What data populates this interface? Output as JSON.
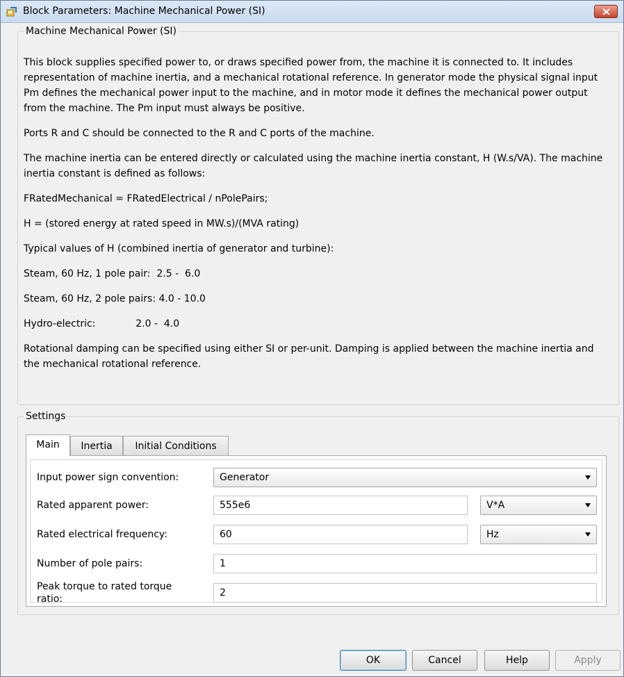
{
  "window": {
    "title": "Block Parameters: Machine Mechanical Power (SI)"
  },
  "description": {
    "group_title": "Machine Mechanical Power (SI)",
    "paragraphs": [
      "This block supplies specified power to, or draws specified power from, the machine it is connected to. It includes representation of machine inertia, and a mechanical rotational reference. In generator mode the physical signal input Pm defines the mechanical power input to the machine, and in motor mode it defines the mechanical power output from the machine. The Pm input must always be positive.",
      "Ports R and C should be connected to the R and C ports of the machine.",
      "The machine inertia can be entered directly or calculated using the machine inertia constant, H (W.s/VA). The machine inertia constant is defined as follows:",
      "FRatedMechanical = FRatedElectrical / nPolePairs;",
      "H = (stored energy at rated speed in MW.s)/(MVA rating)",
      "Typical values of H (combined inertia of generator and turbine):",
      "Steam, 60 Hz, 1 pole pair:  2.5 -  6.0",
      "Steam, 60 Hz, 2 pole pairs: 4.0 - 10.0",
      "Hydro-electric:             2.0 -  4.0",
      "Rotational damping can be specified using either SI or per-unit. Damping is applied between the machine inertia and the mechanical rotational reference."
    ]
  },
  "settings": {
    "group_title": "Settings",
    "tabs": [
      "Main",
      "Inertia",
      "Initial Conditions"
    ],
    "active_tab": "Main",
    "rows": [
      {
        "label": "Input power sign convention:",
        "value": "Generator",
        "kind": "dropdown"
      },
      {
        "label": "Rated apparent power:",
        "value": "555e6",
        "unit": "V*A"
      },
      {
        "label": "Rated electrical frequency:",
        "value": "60",
        "unit": "Hz"
      },
      {
        "label": "Number of pole pairs:",
        "value": "1"
      },
      {
        "label": "Peak torque to rated torque ratio:",
        "value": "2"
      }
    ]
  },
  "buttons": {
    "ok": "OK",
    "cancel": "Cancel",
    "help": "Help",
    "apply": "Apply"
  },
  "colors": {
    "window_bg": "#f0f0f0",
    "titlebar": "#dbe8f6",
    "close_button": "#c7432a"
  }
}
